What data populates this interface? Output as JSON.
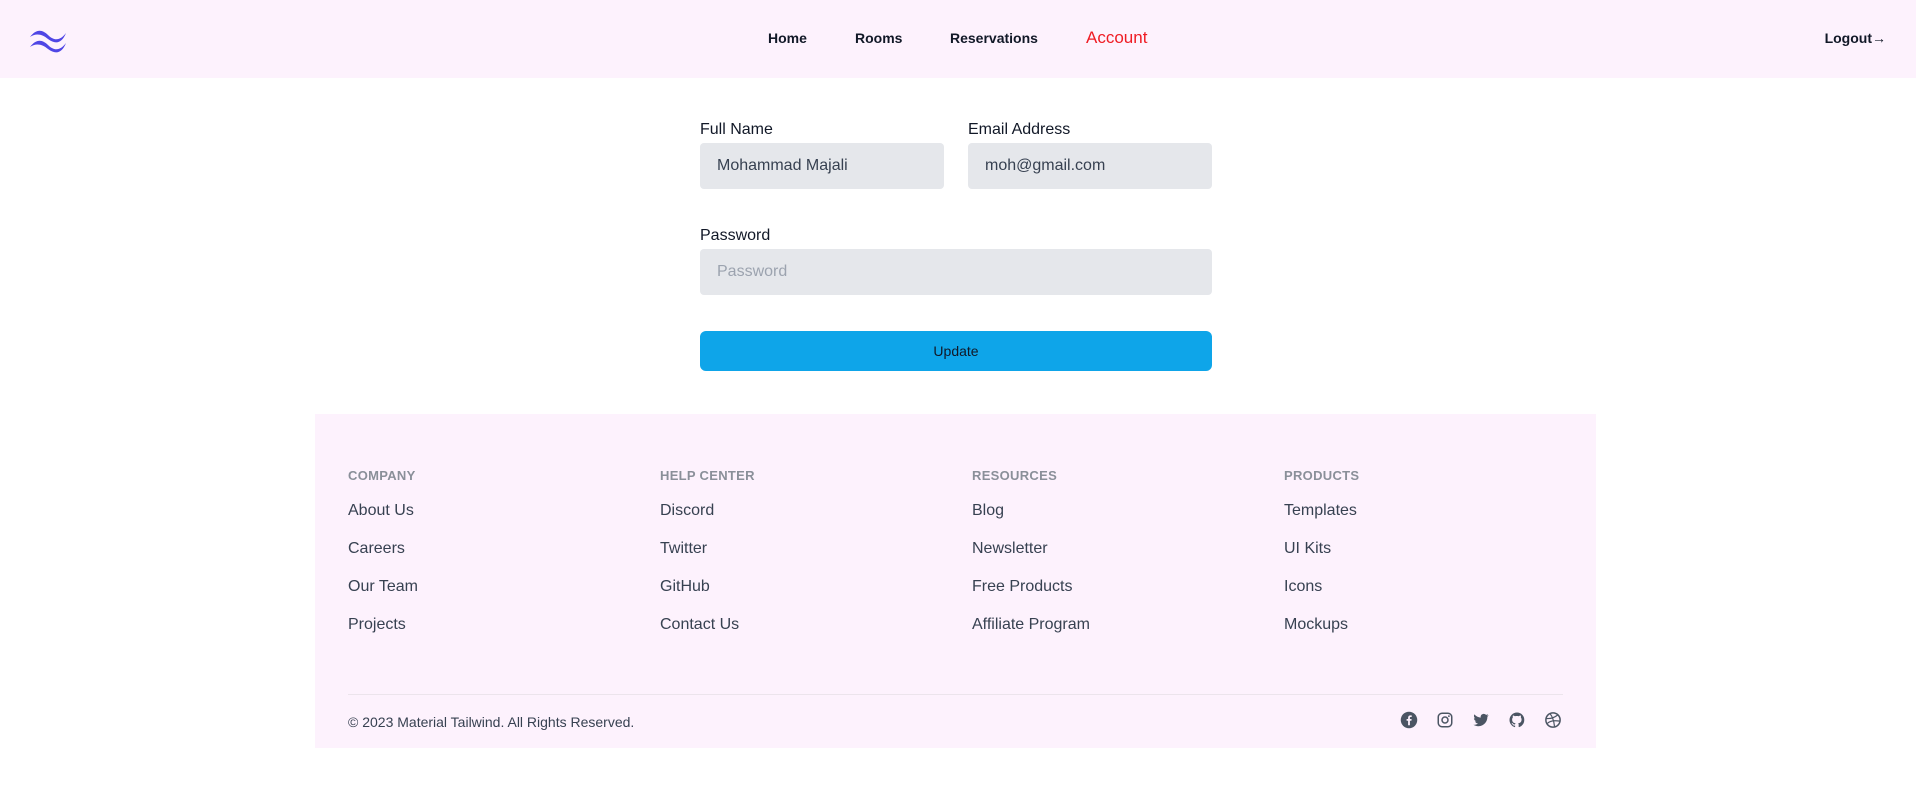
{
  "header": {
    "logo_icon": "tailwind-wave-logo",
    "nav": [
      {
        "label": "Home"
      },
      {
        "label": "Rooms"
      },
      {
        "label": "Reservations"
      },
      {
        "label": "Account",
        "active": true
      }
    ],
    "logout_label": "Logout→"
  },
  "form": {
    "full_name": {
      "label": "Full Name",
      "value": "Mohammad Majali"
    },
    "email": {
      "label": "Email Address",
      "value": "moh@gmail.com"
    },
    "password": {
      "label": "Password",
      "placeholder": "Password",
      "value": ""
    },
    "update_label": "Update"
  },
  "footer": {
    "columns": [
      {
        "title": "COMPANY",
        "links": [
          "About Us",
          "Careers",
          "Our Team",
          "Projects"
        ]
      },
      {
        "title": "HELP CENTER",
        "links": [
          "Discord",
          "Twitter",
          "GitHub",
          "Contact Us"
        ]
      },
      {
        "title": "RESOURCES",
        "links": [
          "Blog",
          "Newsletter",
          "Free Products",
          "Affiliate Program"
        ]
      },
      {
        "title": "PRODUCTS",
        "links": [
          "Templates",
          "UI Kits",
          "Icons",
          "Mockups"
        ]
      }
    ],
    "copyright": "© 2023 Material Tailwind. All Rights Reserved.",
    "social_icons": [
      "facebook-icon",
      "instagram-icon",
      "twitter-icon",
      "github-icon",
      "dribbble-icon"
    ]
  },
  "colors": {
    "header_bg": "#fdf2fd",
    "active_nav": "#ef1c24",
    "button": "#0ea5e9",
    "input_bg": "#e5e7eb",
    "logo": "#4f46e5"
  }
}
